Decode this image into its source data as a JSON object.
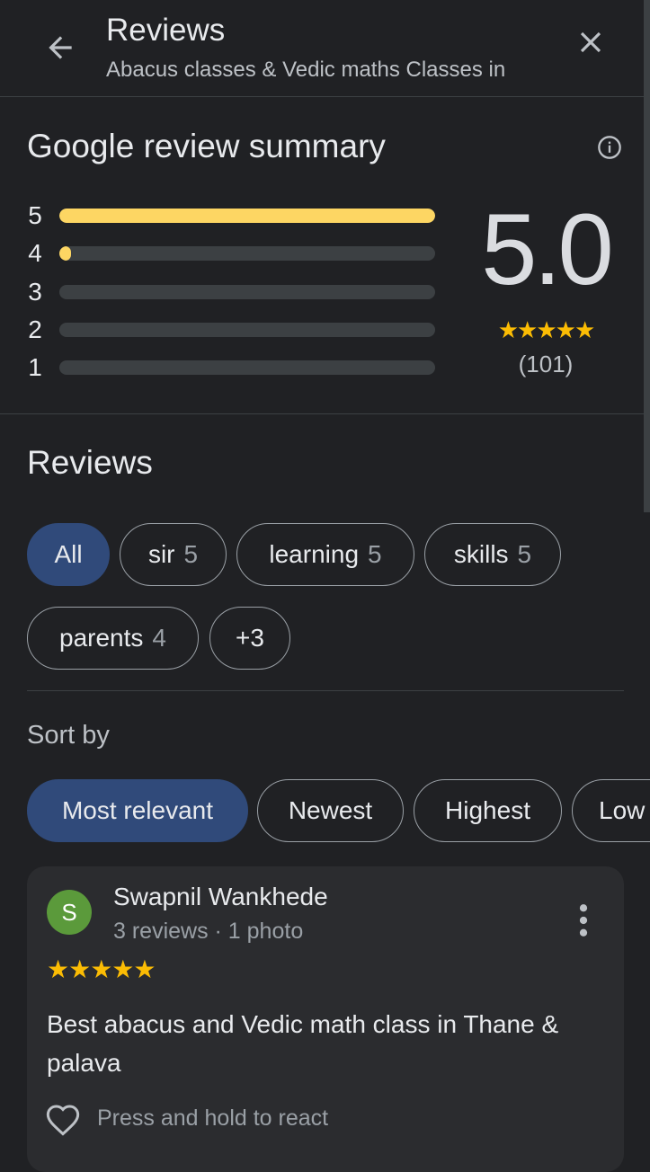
{
  "header": {
    "title": "Reviews",
    "subtitle": "Abacus classes & Vedic maths Classes in",
    "back_icon": "arrow-back-icon",
    "close_icon": "close-icon"
  },
  "summary": {
    "title": "Google review summary",
    "info_icon": "info-icon",
    "bars": [
      {
        "label": "5",
        "fraction": 1.0
      },
      {
        "label": "4",
        "fraction": 0.03
      },
      {
        "label": "3",
        "fraction": 0
      },
      {
        "label": "2",
        "fraction": 0
      },
      {
        "label": "1",
        "fraction": 0
      }
    ],
    "rating": "5.0",
    "stars": "★★★★★",
    "count": "(101)"
  },
  "reviews": {
    "heading": "Reviews",
    "topics": [
      {
        "label": "All",
        "count": ""
      },
      {
        "label": "sir",
        "count": "5"
      },
      {
        "label": "learning",
        "count": "5"
      },
      {
        "label": "skills",
        "count": "5"
      },
      {
        "label": "parents",
        "count": "4"
      },
      {
        "label": "+3",
        "count": ""
      }
    ],
    "sort_label": "Sort by",
    "sort_options": [
      "Most relevant",
      "Newest",
      "Highest",
      "Low"
    ]
  },
  "review": {
    "avatar_letter": "S",
    "name": "Swapnil Wankhede",
    "meta": "3 reviews · 1 photo",
    "stars": "★★★★★",
    "text": "Best abacus and Vedic math class in Thane & palava",
    "react_label": "Press and hold to react"
  },
  "colors": {
    "background": "#202124",
    "accent_chip": "#304a7a",
    "bar_fill": "#fdd663",
    "star": "#fbbc04",
    "avatar": "#5b9a3b"
  }
}
